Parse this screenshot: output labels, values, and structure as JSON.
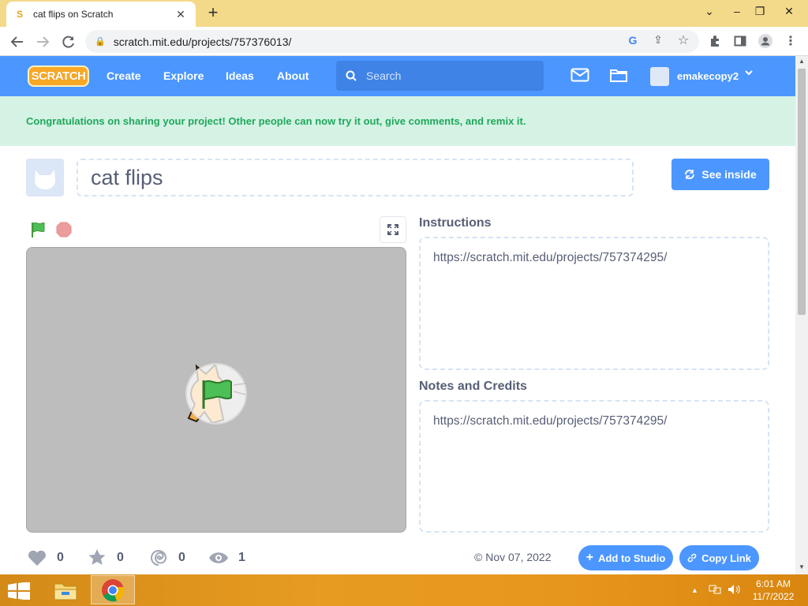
{
  "browser": {
    "tab_title": "cat flips on Scratch",
    "tab_favicon": "S",
    "new_tab": "+",
    "url": "scratch.mit.edu/projects/757376013/",
    "window_controls": {
      "minimize": "–",
      "restore": "❐",
      "close": "✕",
      "dropdown": "⌄"
    }
  },
  "scratch_nav": {
    "logo": "SCRATCH",
    "links": [
      "Create",
      "Explore",
      "Ideas",
      "About"
    ],
    "search_placeholder": "Search",
    "username": "emakecopy2"
  },
  "banner": {
    "message": "Congratulations on sharing your project! Other people can now try it out, give comments, and remix it."
  },
  "project": {
    "title": "cat flips",
    "see_inside_label": "See inside",
    "instructions_heading": "Instructions",
    "instructions_text": "https://scratch.mit.edu/projects/757374295/",
    "notes_heading": "Notes and Credits",
    "notes_text": "https://scratch.mit.edu/projects/757374295/",
    "stats": {
      "loves": "0",
      "favorites": "0",
      "remixes": "0",
      "views": "1"
    },
    "date": "Nov 07, 2022",
    "add_to_studio_label": "Add to Studio",
    "copy_link_label": "Copy Link"
  },
  "taskbar": {
    "time": "6:01 AM",
    "date": "11/7/2022"
  },
  "colors": {
    "scratch_blue": "#4c97ff",
    "banner_bg": "#d5f3e5",
    "banner_text": "#1fa85b",
    "stage_bg": "#bdbdbd"
  }
}
